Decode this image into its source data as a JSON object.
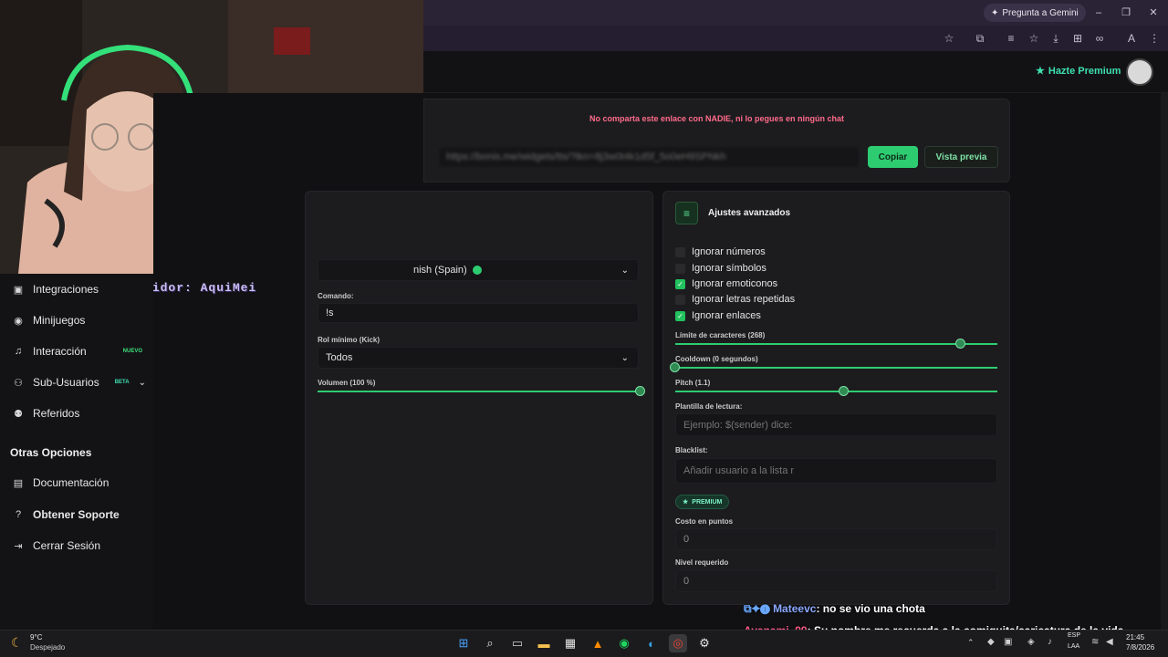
{
  "browser": {
    "gemini_label": "Pregunta a Gemini",
    "min_icon": "minimize-icon",
    "max_icon": "maximize-icon",
    "close_icon": "close-icon"
  },
  "header": {
    "premium_label": "Hazte Premium"
  },
  "overlay": {
    "last_follower": "último seguidor: AquiMei"
  },
  "sidebar": {
    "items": [
      {
        "label": "Integraciones",
        "icon": "integrations-icon"
      },
      {
        "label": "Minijuegos",
        "icon": "gamepad-icon"
      },
      {
        "label": "Interacción",
        "icon": "music-note-icon",
        "badge": "NUEVO"
      },
      {
        "label": "Sub-Usuarios",
        "icon": "users-icon",
        "badge": "BETA"
      },
      {
        "label": "Referidos",
        "icon": "referrals-icon"
      }
    ],
    "section_title": "Otras Opciones",
    "other_items": [
      {
        "label": "Documentación",
        "icon": "document-icon"
      },
      {
        "label": "Obtener Soporte",
        "icon": "help-icon"
      },
      {
        "label": "Cerrar Sesión",
        "icon": "logout-icon"
      }
    ]
  },
  "link_panel": {
    "warning": "No comparta este enlace con NADIE, ni lo pegues en ningún chat",
    "url": "https://bonis.me/widgets/tts/?tkn=8j3w0t4k1d5f_5o0eH9SPNkh",
    "copy_label": "Copiar",
    "preview_label": "Vista previa"
  },
  "tts_panel": {
    "voice_value": "nish (Spain)",
    "command_label": "Comando:",
    "command_value": "!s",
    "role_label": "Rol mínimo (Kick)",
    "role_value": "Todos",
    "volume_label": "Volumen (100 %)",
    "volume_value": 1.0
  },
  "advanced": {
    "title": "Ajustes avanzados",
    "checkboxes": [
      {
        "label": "Ignorar números",
        "checked": false
      },
      {
        "label": "Ignorar símbolos",
        "checked": false
      },
      {
        "label": "Ignorar emoticonos",
        "checked": true
      },
      {
        "label": "Ignorar letras repetidas",
        "checked": false
      },
      {
        "label": "Ignorar enlaces",
        "checked": true
      }
    ],
    "char_limit_label": "Límite de caracteres (268)",
    "char_limit_value": 268,
    "cooldown_label": "Cooldown (0 segundos)",
    "cooldown_value": 0,
    "pitch_label": "Pitch (1.1)",
    "pitch_value": 1.1,
    "template_label": "Plantilla de lectura:",
    "template_placeholder": "Ejemplo: $(sender) dice:",
    "blacklist_label": "Blacklist:",
    "blacklist_placeholder": "Añadir usuario a la lista r",
    "premium_badge": "PREMIUM",
    "cost_label": "Costo en puntos",
    "cost_value": "0",
    "level_label": "Nivel requerido",
    "level_value": "0"
  },
  "chat": [
    {
      "user": "Mateevc",
      "user_color": "#8aa8ff",
      "message": ": no se vio una chota"
    },
    {
      "user": "Ayanami_99",
      "user_color": "#ff5a8a",
      "message": ": Su nombre me recuerda a la comiquita/caricatura de la vida moderna de rocko"
    }
  ],
  "taskbar": {
    "weather_temp": "9°C",
    "weather_desc": "Despejado",
    "lang": "ESP",
    "lang2": "LAA",
    "time": "21:45",
    "date": "7/8/2026"
  },
  "colors": {
    "accent": "#2ecc71",
    "warning": "#ff6b8a",
    "premium": "#3ee0b0"
  }
}
